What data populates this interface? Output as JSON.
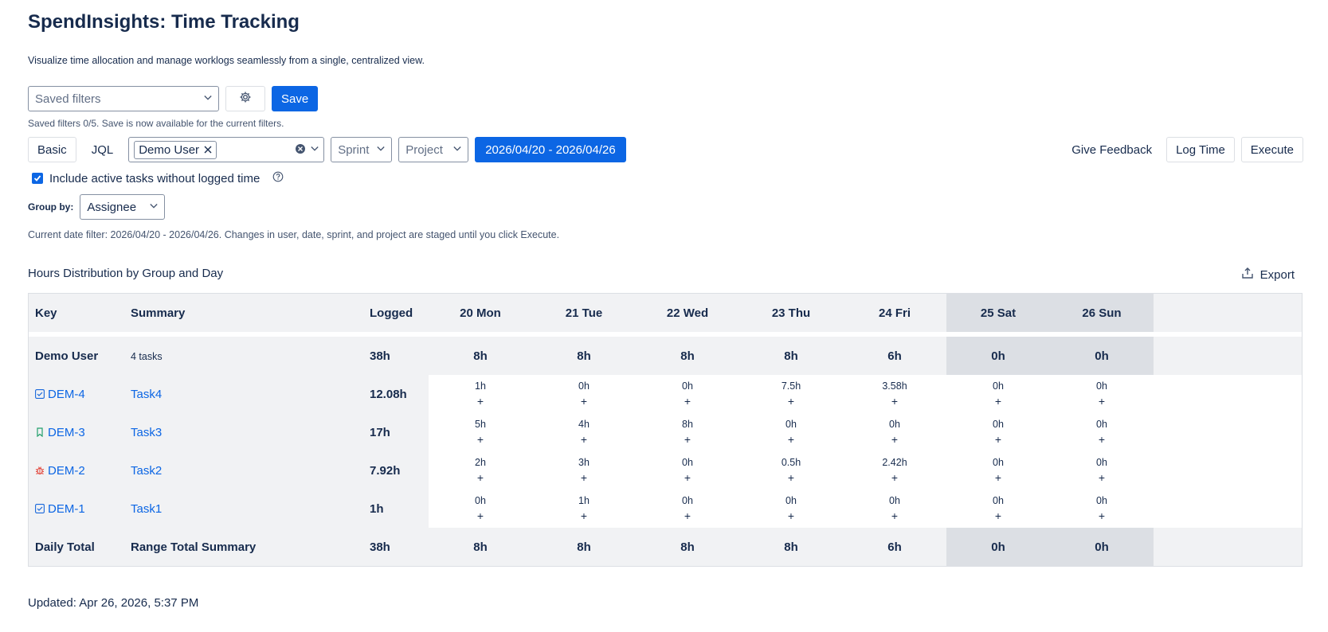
{
  "header": {
    "title": "SpendInsights: Time Tracking",
    "subtitle": "Visualize time allocation and manage worklogs seamlessly from a single, centralized view."
  },
  "filters": {
    "saved_filters_placeholder": "Saved filters",
    "save_label": "Save",
    "saved_hint": "Saved filters 0/5. Save is now available for the current filters.",
    "basic_label": "Basic",
    "jql_label": "JQL",
    "user_chip": "Demo User",
    "sprint_placeholder": "Sprint",
    "project_placeholder": "Project",
    "date_range": "2026/04/20 - 2026/04/26",
    "include_label": "Include active tasks without logged time",
    "group_by_label": "Group by:",
    "group_by_value": "Assignee",
    "note": "Current date filter: 2026/04/20 - 2026/04/26. Changes in user, date, sprint, and project are staged until you click Execute."
  },
  "actions": {
    "feedback": "Give Feedback",
    "log_time": "Log Time",
    "execute": "Execute",
    "export": "Export"
  },
  "section_title": "Hours Distribution by Group and Day",
  "table": {
    "headers": [
      "Key",
      "Summary",
      "Logged",
      "20 Mon",
      "21 Tue",
      "22 Wed",
      "23 Thu",
      "24 Fri",
      "25 Sat",
      "26 Sun"
    ],
    "group": {
      "name": "Demo User",
      "count": "4 tasks",
      "logged": "38h",
      "days": [
        "8h",
        "8h",
        "8h",
        "8h",
        "6h",
        "0h",
        "0h"
      ]
    },
    "rows": [
      {
        "key": "DEM-4",
        "type": "task-icon",
        "summary": "Task4",
        "logged": "12.08h",
        "days": [
          "1h",
          "0h",
          "0h",
          "7.5h",
          "3.58h",
          "0h",
          "0h"
        ]
      },
      {
        "key": "DEM-3",
        "type": "story-icon",
        "summary": "Task3",
        "logged": "17h",
        "days": [
          "5h",
          "4h",
          "8h",
          "0h",
          "0h",
          "0h",
          "0h"
        ]
      },
      {
        "key": "DEM-2",
        "type": "bug-icon",
        "summary": "Task2",
        "logged": "7.92h",
        "days": [
          "2h",
          "3h",
          "0h",
          "0.5h",
          "2.42h",
          "0h",
          "0h"
        ]
      },
      {
        "key": "DEM-1",
        "type": "task-icon",
        "summary": "Task1",
        "logged": "1h",
        "days": [
          "0h",
          "1h",
          "0h",
          "0h",
          "0h",
          "0h",
          "0h"
        ]
      }
    ],
    "add_symbol": "+",
    "total": {
      "label": "Daily Total",
      "summary": "Range Total Summary",
      "logged": "38h",
      "days": [
        "8h",
        "8h",
        "8h",
        "8h",
        "6h",
        "0h",
        "0h"
      ]
    }
  },
  "updated": "Updated: Apr 26, 2026, 5:37 PM",
  "colors": {
    "primary": "#0c66e4",
    "header_bg": "#f1f2f4",
    "weekend_bg": "#dcdfe4",
    "bug": "#e2483d",
    "story": "#22a06b"
  }
}
